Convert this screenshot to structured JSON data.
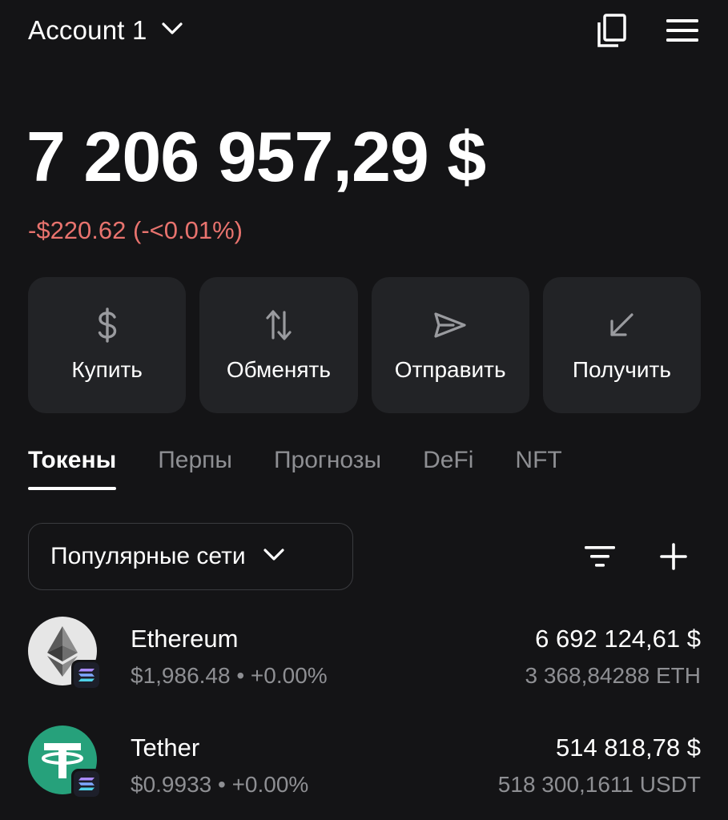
{
  "header": {
    "account_name": "Account 1",
    "icons": [
      "chevron-down-icon",
      "copy-icon",
      "menu-icon"
    ]
  },
  "balance": {
    "total": "7 206 957,29 $",
    "change": "-$220.62 (-<0.01%)",
    "change_color": "#e8736e"
  },
  "actions": [
    {
      "label": "Купить",
      "icon": "dollar-icon"
    },
    {
      "label": "Обменять",
      "icon": "swap-icon"
    },
    {
      "label": "Отправить",
      "icon": "send-icon"
    },
    {
      "label": "Получить",
      "icon": "receive-icon"
    }
  ],
  "tabs": [
    {
      "label": "Токены",
      "active": true
    },
    {
      "label": "Перпы",
      "active": false
    },
    {
      "label": "Прогнозы",
      "active": false
    },
    {
      "label": "DeFi",
      "active": false
    },
    {
      "label": "NFT",
      "active": false
    }
  ],
  "filters": {
    "network_label": "Популярные сети"
  },
  "tokens": [
    {
      "name": "Ethereum",
      "price": "$1,986.48 • +0.00%",
      "value": "6 692 124,61 $",
      "amount": "3 368,84288 ETH",
      "icon": "ethereum-icon",
      "color": "#e6e6e6"
    },
    {
      "name": "Tether",
      "price": "$0.9933 • +0.00%",
      "value": "514 818,78 $",
      "amount": "518 300,1611 USDT",
      "icon": "tether-icon",
      "color": "#26a17b"
    }
  ],
  "colors": {
    "background": "#141416",
    "card": "#222326",
    "muted": "#8e8f93"
  }
}
